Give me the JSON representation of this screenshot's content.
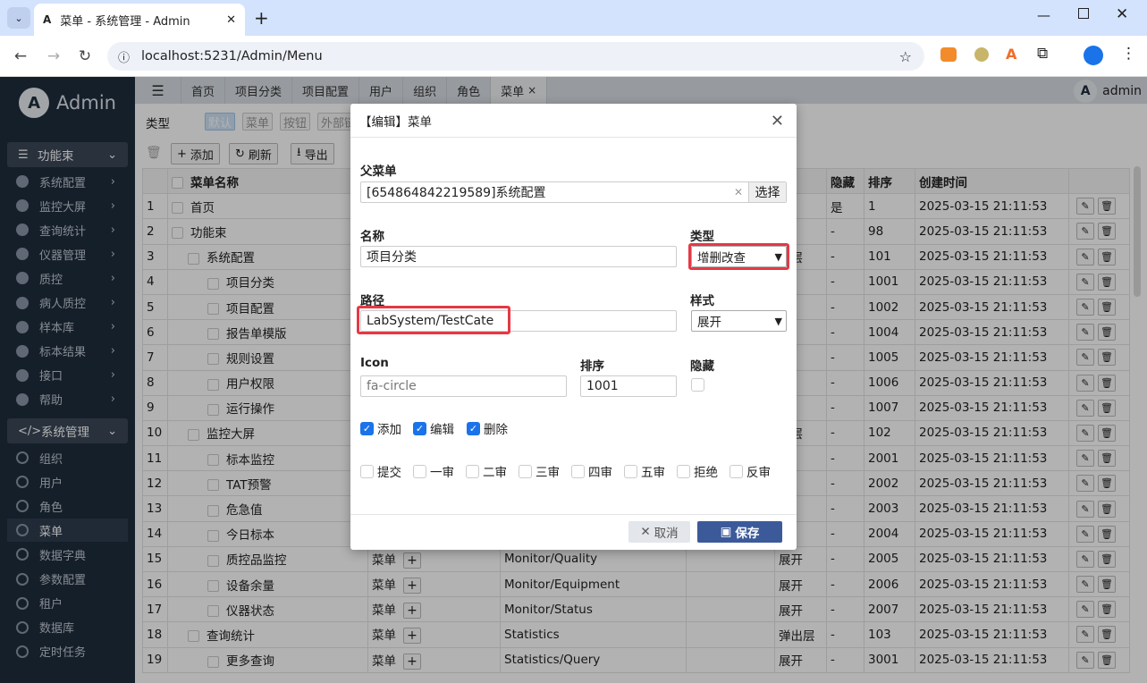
{
  "browser": {
    "tab_title": "菜单 - 系统管理 - Admin",
    "url": "localhost:5231/Admin/Menu"
  },
  "sidebar": {
    "logo_text": "Admin",
    "group1": "功能束",
    "group1_items": [
      "系统配置",
      "监控大屏",
      "查询统计",
      "仪器管理",
      "质控",
      "病人质控",
      "样本库",
      "标本结果",
      "接口",
      "帮助"
    ],
    "group2": "系统管理",
    "group2_items": [
      "组织",
      "用户",
      "角色",
      "菜单",
      "数据字典",
      "参数配置",
      "租户",
      "数据库",
      "定时任务"
    ],
    "active": "菜单"
  },
  "topnav": {
    "tabs": [
      "首页",
      "项目分类",
      "项目配置",
      "用户",
      "组织",
      "角色",
      "菜单"
    ],
    "active_tab": "菜单",
    "user": "admin"
  },
  "toolbar": {
    "type_label": "类型",
    "chips": [
      "默认",
      "菜单",
      "按钮",
      "外部链"
    ],
    "add": "添加",
    "refresh": "刷新",
    "export": "导出"
  },
  "table": {
    "headers": {
      "name": "菜单名称",
      "hidden": "隐藏",
      "sort": "排序",
      "created": "创建时间"
    },
    "rows": [
      {
        "no": "1",
        "indent": 0,
        "name": "首页",
        "type": "",
        "path": "",
        "style": "",
        "hidden": "是",
        "sort": "1",
        "created": "2025-03-15 21:11:53"
      },
      {
        "no": "2",
        "indent": 0,
        "name": "功能束",
        "type": "",
        "path": "",
        "style": "",
        "hidden": "-",
        "sort": "98",
        "created": "2025-03-15 21:11:53"
      },
      {
        "no": "3",
        "indent": 1,
        "name": "系统配置",
        "type": "",
        "path": "",
        "style": "出层",
        "hidden": "-",
        "sort": "101",
        "created": "2025-03-15 21:11:53"
      },
      {
        "no": "4",
        "indent": 2,
        "name": "项目分类",
        "type": "",
        "path": "",
        "style": "",
        "hidden": "-",
        "sort": "1001",
        "created": "2025-03-15 21:11:53"
      },
      {
        "no": "5",
        "indent": 2,
        "name": "项目配置",
        "type": "",
        "path": "",
        "style": "",
        "hidden": "-",
        "sort": "1002",
        "created": "2025-03-15 21:11:53"
      },
      {
        "no": "6",
        "indent": 2,
        "name": "报告单模版",
        "type": "",
        "path": "",
        "style": "",
        "hidden": "-",
        "sort": "1004",
        "created": "2025-03-15 21:11:53"
      },
      {
        "no": "7",
        "indent": 2,
        "name": "规则设置",
        "type": "",
        "path": "",
        "style": "",
        "hidden": "-",
        "sort": "1005",
        "created": "2025-03-15 21:11:53"
      },
      {
        "no": "8",
        "indent": 2,
        "name": "用户权限",
        "type": "",
        "path": "",
        "style": "",
        "hidden": "-",
        "sort": "1006",
        "created": "2025-03-15 21:11:53"
      },
      {
        "no": "9",
        "indent": 2,
        "name": "运行操作",
        "type": "",
        "path": "",
        "style": "",
        "hidden": "-",
        "sort": "1007",
        "created": "2025-03-15 21:11:53"
      },
      {
        "no": "10",
        "indent": 1,
        "name": "监控大屏",
        "type": "",
        "path": "",
        "style": "出层",
        "hidden": "-",
        "sort": "102",
        "created": "2025-03-15 21:11:53"
      },
      {
        "no": "11",
        "indent": 2,
        "name": "标本监控",
        "type": "",
        "path": "",
        "style": "",
        "hidden": "-",
        "sort": "2001",
        "created": "2025-03-15 21:11:53"
      },
      {
        "no": "12",
        "indent": 2,
        "name": "TAT预警",
        "type": "",
        "path": "",
        "style": "",
        "hidden": "-",
        "sort": "2002",
        "created": "2025-03-15 21:11:53"
      },
      {
        "no": "13",
        "indent": 2,
        "name": "危急值",
        "type": "",
        "path": "",
        "style": "",
        "hidden": "-",
        "sort": "2003",
        "created": "2025-03-15 21:11:53"
      },
      {
        "no": "14",
        "indent": 2,
        "name": "今日标本",
        "type": "",
        "path": "",
        "style": "",
        "hidden": "-",
        "sort": "2004",
        "created": "2025-03-15 21:11:53"
      },
      {
        "no": "15",
        "indent": 2,
        "name": "质控品监控",
        "type": "菜单",
        "path": "Monitor/Quality",
        "style": "展开",
        "hidden": "-",
        "sort": "2005",
        "created": "2025-03-15 21:11:53"
      },
      {
        "no": "16",
        "indent": 2,
        "name": "设备余量",
        "type": "菜单",
        "path": "Monitor/Equipment",
        "style": "展开",
        "hidden": "-",
        "sort": "2006",
        "created": "2025-03-15 21:11:53"
      },
      {
        "no": "17",
        "indent": 2,
        "name": "仪器状态",
        "type": "菜单",
        "path": "Monitor/Status",
        "style": "展开",
        "hidden": "-",
        "sort": "2007",
        "created": "2025-03-15 21:11:53"
      },
      {
        "no": "18",
        "indent": 1,
        "name": "查询统计",
        "type": "菜单",
        "path": "Statistics",
        "style": "弹出层",
        "hidden": "-",
        "sort": "103",
        "created": "2025-03-15 21:11:53"
      },
      {
        "no": "19",
        "indent": 2,
        "name": "更多查询",
        "type": "菜单",
        "path": "Statistics/Query",
        "style": "展开",
        "hidden": "-",
        "sort": "3001",
        "created": "2025-03-15 21:11:53"
      }
    ]
  },
  "modal": {
    "title": "【编辑】菜单",
    "parent_label": "父菜单",
    "parent_value": "[654864842219589]系统配置",
    "select_btn": "选择",
    "name_label": "名称",
    "name_value": "项目分类",
    "type_label": "类型",
    "type_value": "增删改查",
    "path_label": "路径",
    "path_value": "LabSystem/TestCate",
    "style_label": "样式",
    "style_value": "展开",
    "icon_label": "Icon",
    "icon_value": "fa-circle",
    "sort_label": "排序",
    "sort_value": "1001",
    "hidden_label": "隐藏",
    "checked_ops": [
      "添加",
      "编辑",
      "删除"
    ],
    "unchecked_ops": [
      "提交",
      "一审",
      "二审",
      "三审",
      "四审",
      "五审",
      "拒绝",
      "反审"
    ],
    "cancel": "取消",
    "save": "保存"
  }
}
